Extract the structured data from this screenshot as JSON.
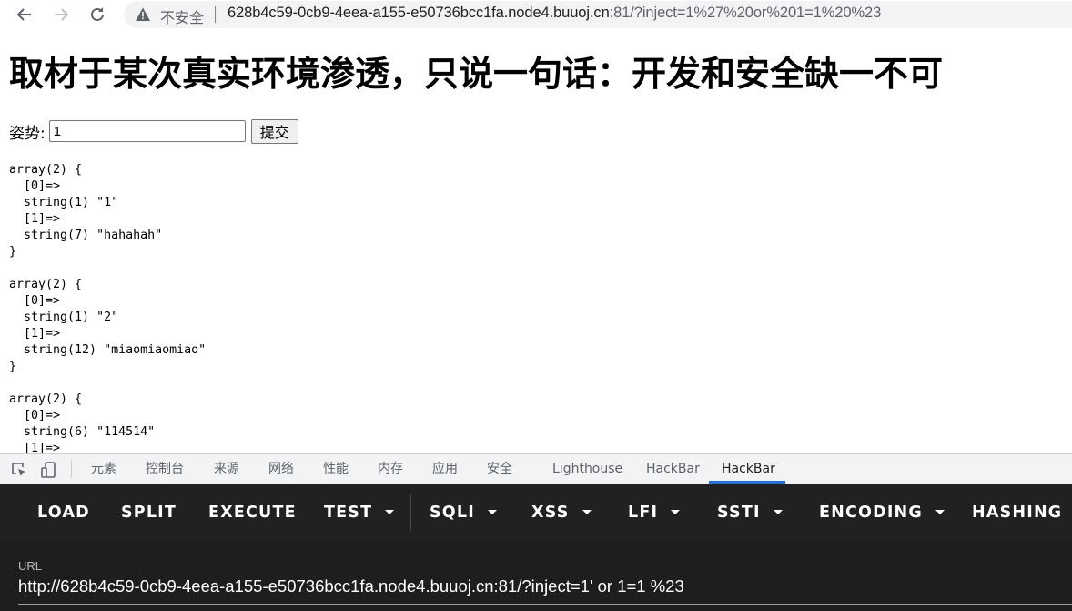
{
  "browser": {
    "security_label": "不安全",
    "url_host": "628b4c59-0cb9-4eea-a155-e50736bcc1fa.node4.buuoj.cn",
    "url_rest": ":81/?inject=1%27%20or%201=1%20%23"
  },
  "page": {
    "heading": "取材于某次真实环境渗透，只说一句话：开发和安全缺一不可",
    "form": {
      "label": "姿势:",
      "input_value": "1",
      "submit_label": "提交"
    },
    "dump_blocks": [
      "array(2) {\n  [0]=>\n  string(1) \"1\"\n  [1]=>\n  string(7) \"hahahah\"\n}",
      "array(2) {\n  [0]=>\n  string(1) \"2\"\n  [1]=>\n  string(12) \"miaomiaomiao\"\n}",
      "array(2) {\n  [0]=>\n  string(6) \"114514\"\n  [1]=>"
    ]
  },
  "devtools": {
    "tabs": [
      "元素",
      "控制台",
      "来源",
      "网络",
      "性能",
      "内存",
      "应用",
      "安全",
      "Lighthouse",
      "HackBar",
      "HackBar"
    ],
    "active_tab_index": 10,
    "accent_color": "#1a73e8"
  },
  "hackbar": {
    "menu": [
      {
        "label": "LOAD",
        "dropdown": false
      },
      {
        "label": "SPLIT",
        "dropdown": false
      },
      {
        "label": "EXECUTE",
        "dropdown": false
      },
      {
        "label": "TEST",
        "dropdown": true
      },
      {
        "label": "SQLI",
        "dropdown": true
      },
      {
        "label": "XSS",
        "dropdown": true
      },
      {
        "label": "LFI",
        "dropdown": true
      },
      {
        "label": "SSTI",
        "dropdown": true
      },
      {
        "label": "ENCODING",
        "dropdown": true
      },
      {
        "label": "HASHING",
        "dropdown": true
      }
    ],
    "url_label": "URL",
    "url_value": "http://628b4c59-0cb9-4eea-a155-e50736bcc1fa.node4.buuoj.cn:81/?inject=1' or 1=1 %23"
  },
  "icons": {
    "back": "back-arrow-icon",
    "forward": "forward-arrow-icon",
    "reload": "reload-icon",
    "security": "warning-triangle-icon",
    "inspect": "inspect-element-icon",
    "device": "device-toolbar-icon"
  }
}
